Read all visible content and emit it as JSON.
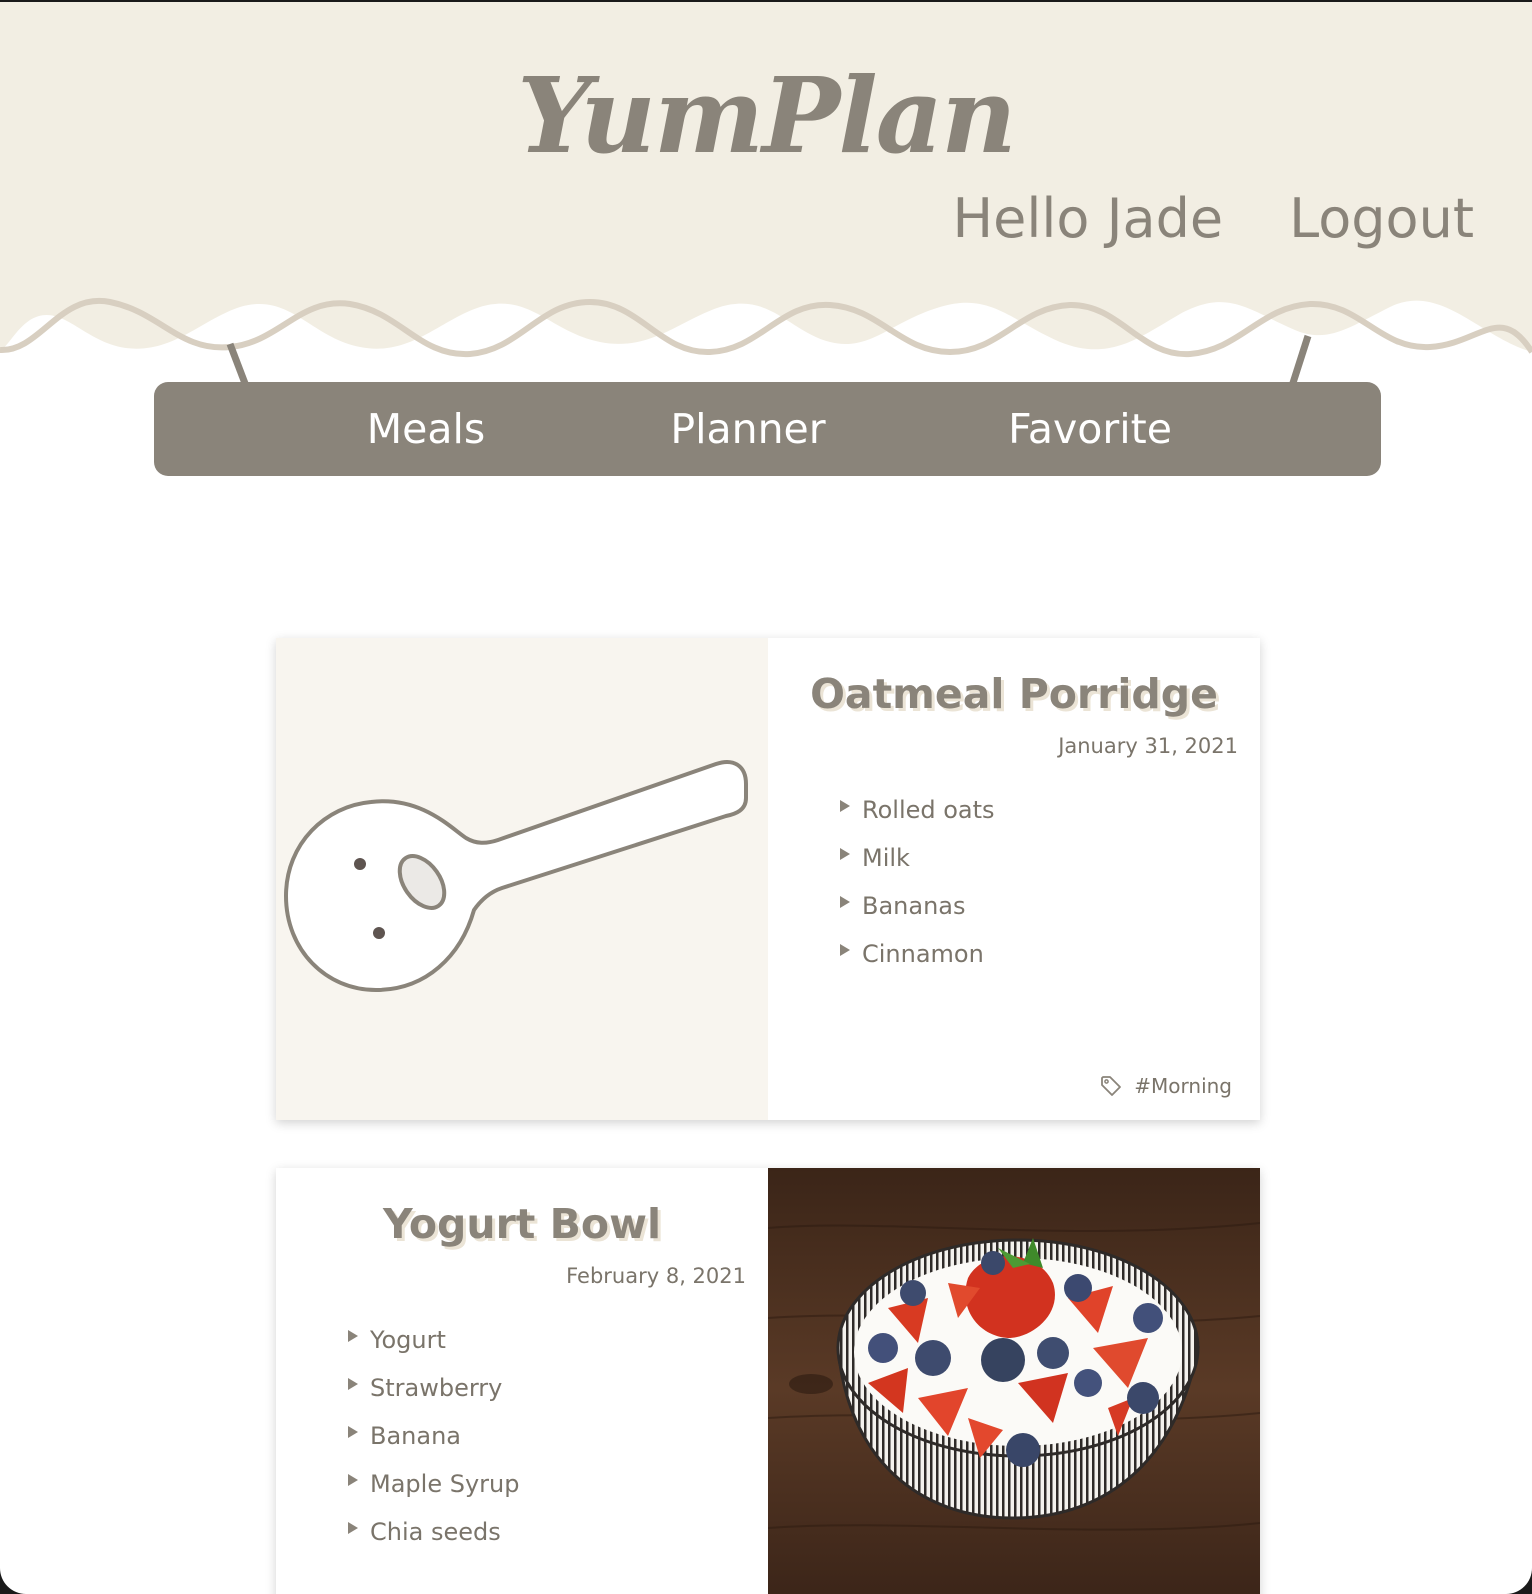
{
  "app": {
    "logo": "YumPlan"
  },
  "header": {
    "greeting": "Hello Jade",
    "logout_label": "Logout"
  },
  "nav": {
    "items": [
      {
        "label": "Meals"
      },
      {
        "label": "Planner"
      },
      {
        "label": "Favorite"
      }
    ]
  },
  "colors": {
    "header_bg": "#f2eee3",
    "wave_stroke": "#d8cfc1",
    "primary": "#8a847a",
    "card_placeholder_bg": "#f8f5ef"
  },
  "meals": [
    {
      "title": "Oatmeal Porridge",
      "date": "January 31, 2021",
      "ingredients": [
        "Rolled oats",
        "Milk",
        "Bananas",
        "Cinnamon"
      ],
      "tag": "#Morning",
      "image": "spoon-placeholder-illustration"
    },
    {
      "title": "Yogurt Bowl",
      "date": "February 8, 2021",
      "ingredients": [
        "Yogurt",
        "Strawberry",
        "Banana",
        "Maple Syrup",
        "Chia seeds"
      ],
      "image": "yogurt-bowl-photo"
    }
  ]
}
